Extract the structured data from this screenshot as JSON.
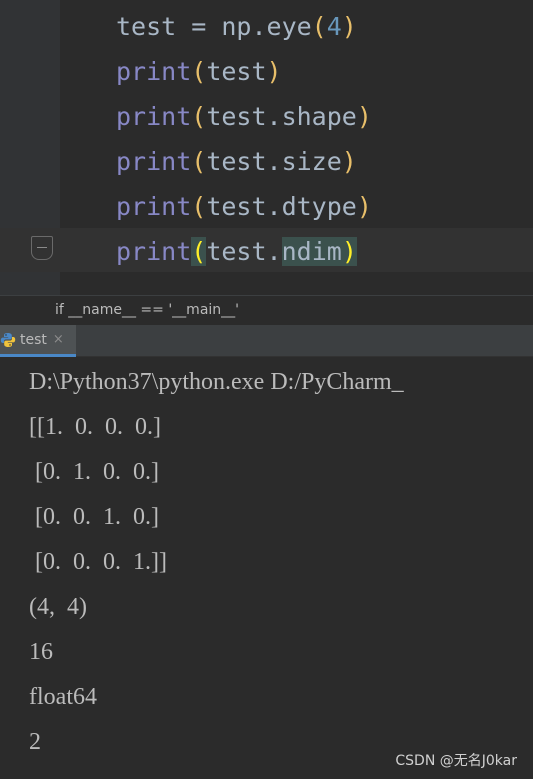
{
  "editor": {
    "lines": [
      {
        "indent": "",
        "parts": [
          {
            "t": "test = np.eye",
            "c": "plain"
          },
          {
            "t": "(",
            "c": "paren-y"
          },
          {
            "t": "4",
            "c": "num"
          },
          {
            "t": ")",
            "c": "paren-y"
          }
        ]
      },
      {
        "parts": [
          {
            "t": "print",
            "c": "kw"
          },
          {
            "t": "(",
            "c": "paren-y"
          },
          {
            "t": "test",
            "c": "plain"
          },
          {
            "t": ")",
            "c": "paren-y"
          }
        ]
      },
      {
        "parts": [
          {
            "t": "print",
            "c": "kw"
          },
          {
            "t": "(",
            "c": "paren-y"
          },
          {
            "t": "test.shape",
            "c": "plain"
          },
          {
            "t": ")",
            "c": "paren-y"
          }
        ]
      },
      {
        "parts": [
          {
            "t": "print",
            "c": "kw"
          },
          {
            "t": "(",
            "c": "paren-y"
          },
          {
            "t": "test.size",
            "c": "plain"
          },
          {
            "t": ")",
            "c": "paren-y"
          }
        ]
      },
      {
        "parts": [
          {
            "t": "print",
            "c": "kw"
          },
          {
            "t": "(",
            "c": "paren-y"
          },
          {
            "t": "test.dtype",
            "c": "plain"
          },
          {
            "t": ")",
            "c": "paren-y"
          }
        ]
      },
      {
        "parts": [
          {
            "t": "print",
            "c": "kw"
          },
          {
            "t": "(",
            "c": "match-paren"
          },
          {
            "t": "test.",
            "c": "plain"
          },
          {
            "t": "ndim",
            "c": "plain match-bg"
          },
          {
            "t": ")",
            "c": "match-paren"
          }
        ]
      }
    ]
  },
  "breadcrumb": {
    "text": "if __name__ == '__main__'"
  },
  "run_tab": {
    "label": "test",
    "close": "×",
    "icon": "python-icon"
  },
  "console": {
    "lines": [
      "D:\\Python37\\python.exe D:/PyCharm_",
      "[[1.  0.  0.  0.]",
      " [0.  1.  0.  0.]",
      " [0.  0.  1.  0.]",
      " [0.  0.  0.  1.]]",
      "(4,  4)",
      "16",
      "float64",
      "2"
    ]
  },
  "watermark": {
    "text": "CSDN @无名J0kar"
  },
  "colors": {
    "background": "#2b2b2b",
    "keyword": "#8888c6",
    "paren": "#e8bf6a",
    "number": "#6897bb",
    "text": "#a9b7c6",
    "tab_accent": "#4a88c7"
  }
}
